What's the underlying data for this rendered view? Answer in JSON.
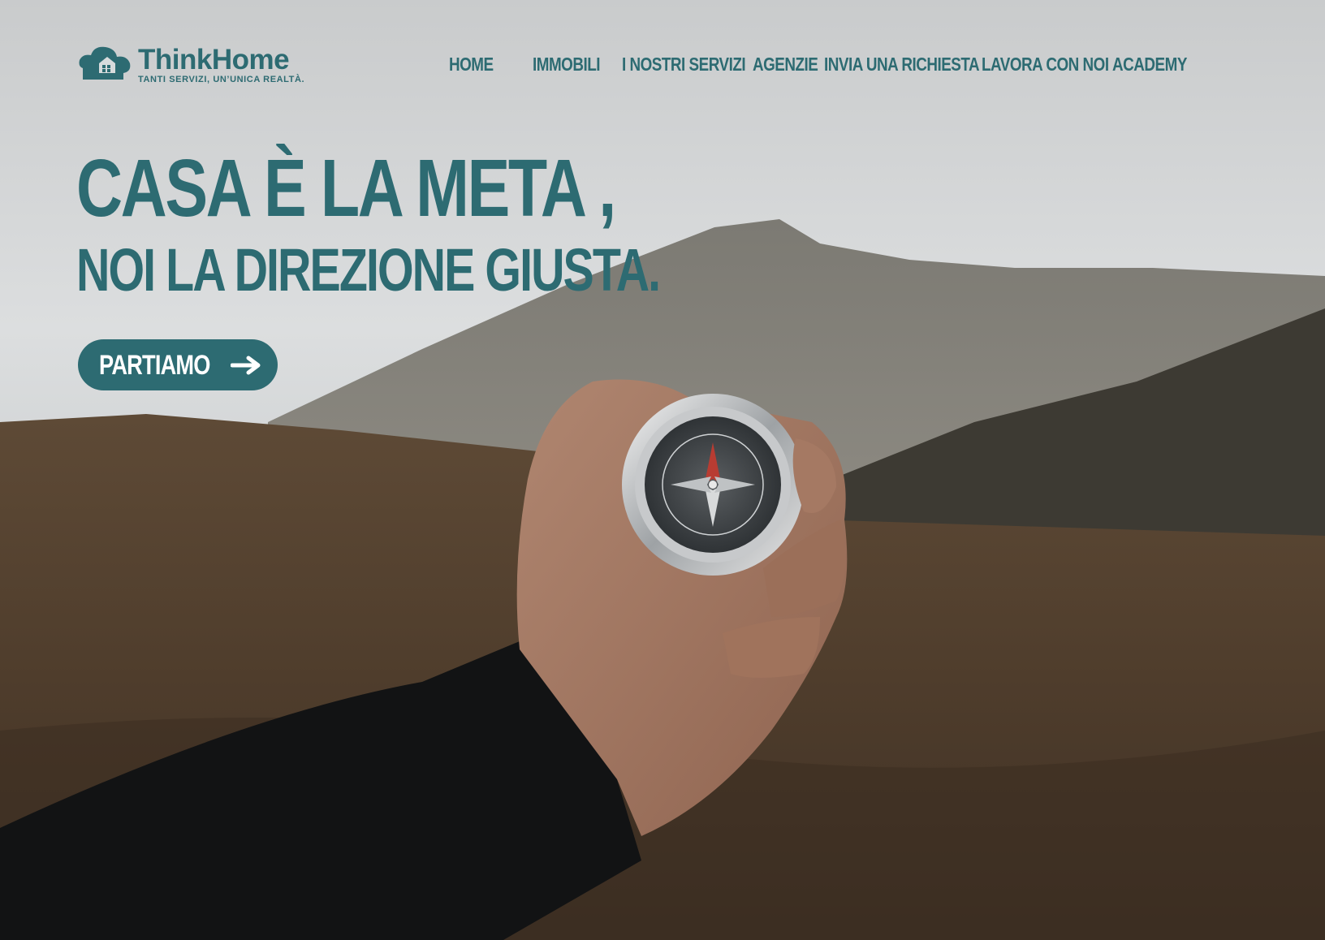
{
  "theme": {
    "brand_color": "#2d6b72",
    "sky_color": "#d6d9da",
    "ground_color": "#5a4632"
  },
  "brand": {
    "name": "ThinkHome",
    "tagline": "TANTI SERVIZI, UN’UNICA REALTÀ.",
    "icon": "cloud-house-logo-icon"
  },
  "nav": {
    "items": [
      {
        "label": "HOME"
      },
      {
        "label": "IMMOBILI"
      },
      {
        "label": "I NOSTRI SERVIZI"
      },
      {
        "label": "AGENZIE"
      },
      {
        "label": "INVIA UNA RICHIESTA"
      },
      {
        "label": "LAVORA CON NOI"
      },
      {
        "label": "ACADEMY"
      }
    ]
  },
  "hero": {
    "headline_line1": "CASA È LA META ,",
    "headline_line2": "NOI LA DIREZIONE GIUSTA.",
    "cta_label": "PARTIAMO",
    "cta_icon": "arrow-right-icon",
    "image_subject": "hand-holding-compass-photo"
  }
}
